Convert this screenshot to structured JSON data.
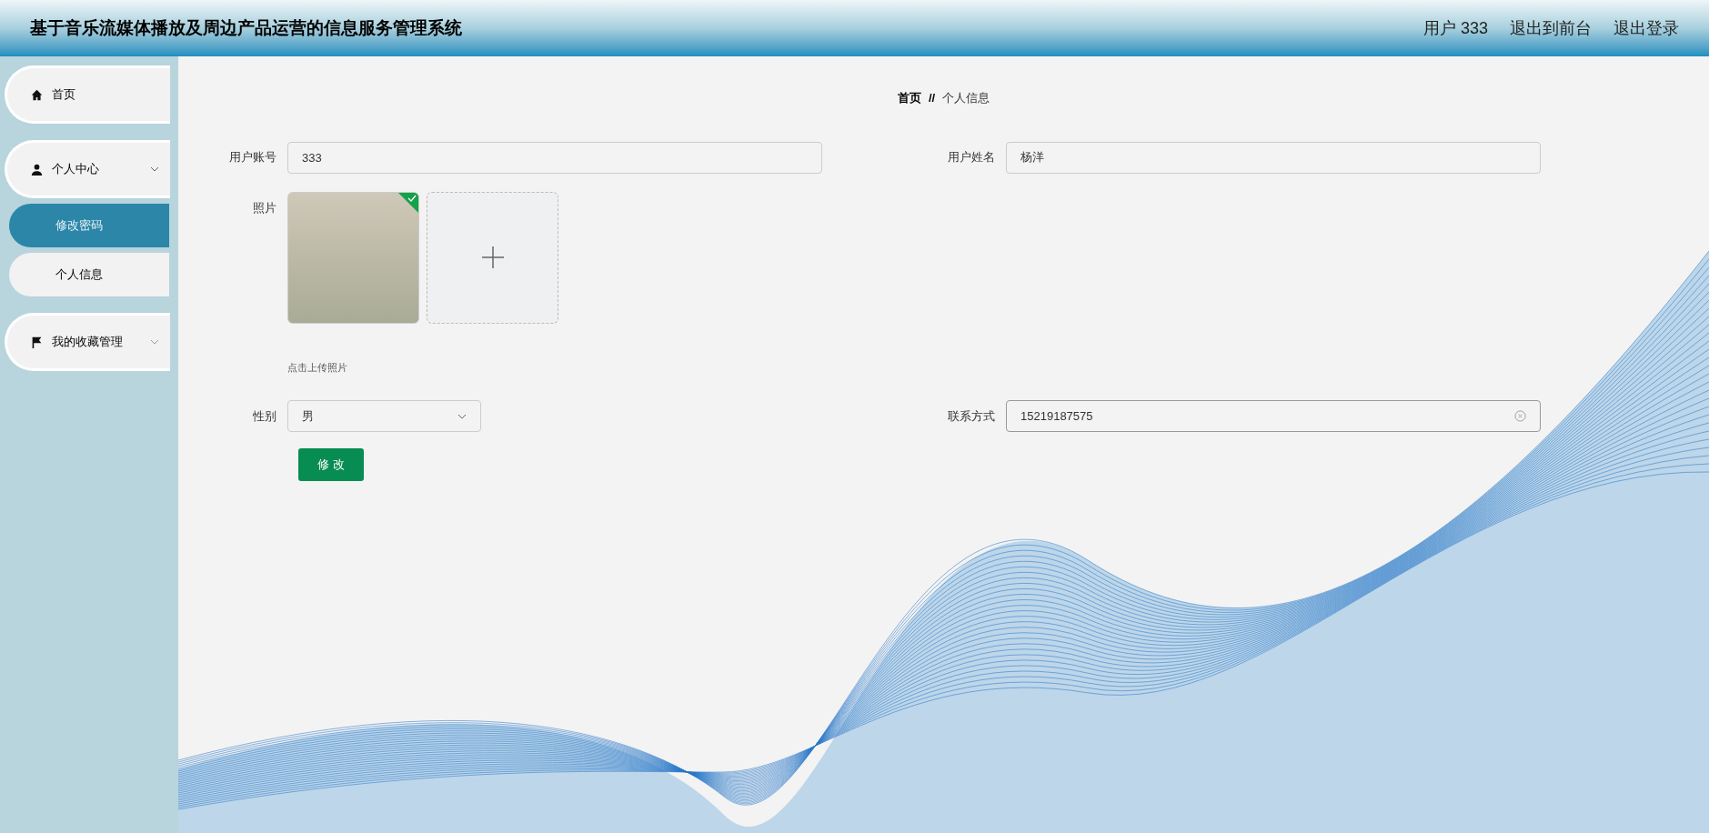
{
  "header": {
    "title": "基于音乐流媒体播放及周边产品运营的信息服务管理系统",
    "user": "用户 333",
    "links": [
      "退出到前台",
      "退出登录"
    ]
  },
  "sidebar": {
    "items": [
      {
        "kind": "home",
        "label": "首页"
      },
      {
        "kind": "user",
        "label": "个人中心",
        "expanded": true,
        "children": [
          {
            "label": "修改密码",
            "selected": true
          },
          {
            "label": "个人信息",
            "selected": false
          }
        ]
      },
      {
        "kind": "flag",
        "label": "我的收藏管理",
        "expanded": false
      }
    ]
  },
  "breadcrumb": {
    "home": "首页",
    "separator": "//",
    "current": "个人信息"
  },
  "form": {
    "account": {
      "label": "用户账号",
      "value": "333"
    },
    "name": {
      "label": "用户姓名",
      "value": "杨洋"
    },
    "photo": {
      "label": "照片",
      "uploaded": true,
      "hint": "点击上传照片"
    },
    "gender": {
      "label": "性别",
      "value": "男"
    },
    "phone": {
      "label": "联系方式",
      "value": "15219187575"
    },
    "submit": "修 改"
  }
}
